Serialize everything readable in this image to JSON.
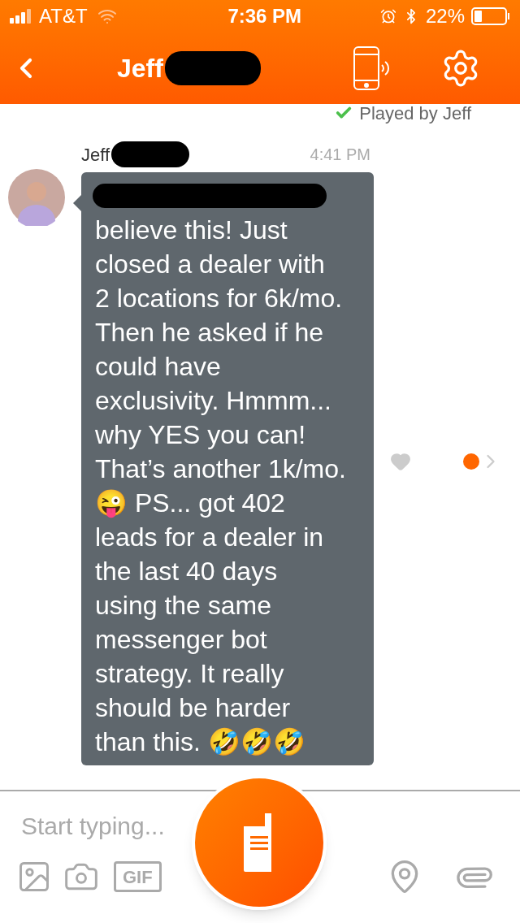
{
  "status_bar": {
    "carrier": "AT&T",
    "time": "7:36 PM",
    "battery": "22%"
  },
  "header": {
    "title": "Jeff"
  },
  "played_by": "Played by Jeff",
  "message": {
    "sender": "Jeff",
    "time": "4:41 PM",
    "text": "believe this! Just\nclosed a dealer with\n2 locations for 6k/mo.\nThen he asked if he\ncould have\nexclusivity. Hmmm...\nwhy YES you can!\nThat’s another 1k/mo.\n😜 PS... got 402\nleads for a dealer in\nthe last 40 days\nusing the same\nmessenger bot\nstrategy. It really\nshould be harder\nthan this. 🤣🤣🤣",
    "liked": false
  },
  "composer": {
    "placeholder": "Start typing...",
    "gif": "GIF"
  }
}
